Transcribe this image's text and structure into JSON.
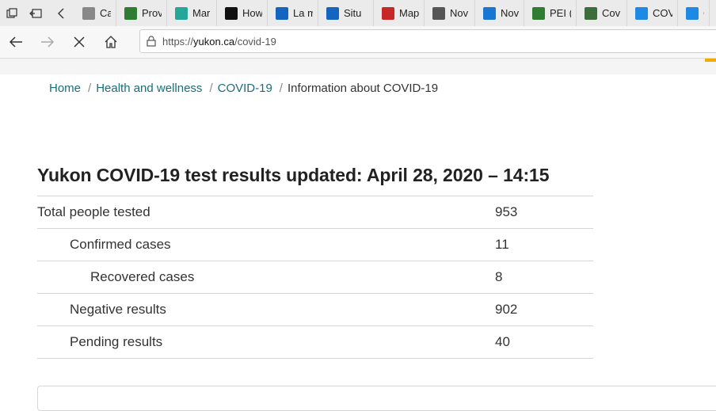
{
  "browser": {
    "tabs": [
      {
        "label": "Case",
        "icon": "generic-page-icon",
        "color": "#888888"
      },
      {
        "label": "Prov",
        "icon": "green-flag-icon",
        "color": "#2e7d32"
      },
      {
        "label": "Mar",
        "icon": "teal-logo-icon",
        "color": "#26a69a"
      },
      {
        "label": "How",
        "icon": "ontario-trillium-icon",
        "color": "#111111"
      },
      {
        "label": "La m",
        "icon": "quebec-fleur-icon",
        "color": "#1565c0"
      },
      {
        "label": "Situ",
        "icon": "quebec-fleur-icon",
        "color": "#1565c0"
      },
      {
        "label": "Map",
        "icon": "red-pen-icon",
        "color": "#c62828"
      },
      {
        "label": "Nov",
        "icon": "nova-scotia-icon",
        "color": "#555555"
      },
      {
        "label": "Nov",
        "icon": "nova-scotia-flag-icon",
        "color": "#1976d2"
      },
      {
        "label": "PEI (",
        "icon": "pei-tree-icon",
        "color": "#2e7d32"
      },
      {
        "label": "Cov",
        "icon": "globe-seal-icon",
        "color": "#3b6e3b"
      },
      {
        "label": "COV",
        "icon": "nunavut-icon",
        "color": "#1e88e5"
      },
      {
        "label": "C",
        "icon": "blue-arc-icon",
        "color": "#1e88e5"
      }
    ],
    "url": {
      "prefix": "https://",
      "host": "yukon.ca",
      "path": "/covid-19"
    }
  },
  "breadcrumb": {
    "home": "Home",
    "health": "Health and wellness",
    "covid": "COVID-19",
    "current": "Information about COVID-19",
    "separator": "/"
  },
  "main": {
    "title": "Yukon COVID-19 test results updated: April 28, 2020 – 14:15",
    "rows": [
      {
        "label": "Total people tested",
        "value": "953"
      },
      {
        "label": "Confirmed cases",
        "value": "11"
      },
      {
        "label": "Recovered cases",
        "value": "8"
      },
      {
        "label": "Negative results",
        "value": "902"
      },
      {
        "label": "Pending results",
        "value": "40"
      }
    ]
  },
  "colors": {
    "link": "#186f7c",
    "accent": "#f2a900"
  }
}
